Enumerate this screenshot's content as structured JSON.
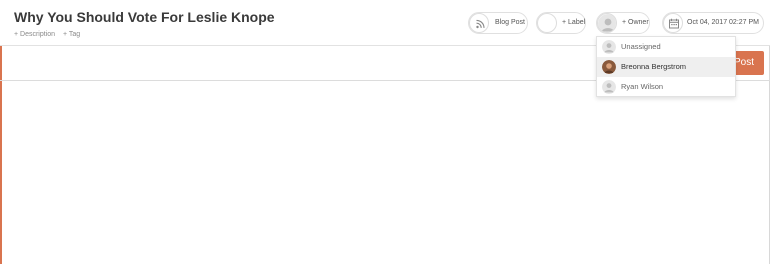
{
  "post": {
    "title": "Why You Should Vote For Leslie Knope",
    "add_description": "+ Description",
    "add_tag": "+ Tag"
  },
  "toolbar": {
    "type_label": "Blog Post",
    "label_label": "+ Label",
    "owner_label": "+ Owner",
    "date_label": "Oct 04, 2017 02:27 PM",
    "post_button": "Post"
  },
  "owner_dropdown": {
    "items": [
      {
        "label": "Unassigned",
        "avatar": "default-avatar-icon",
        "selected": false
      },
      {
        "label": "Breonna Bergstrom",
        "avatar": "user-photo",
        "selected": true
      },
      {
        "label": "Ryan Wilson",
        "avatar": "default-avatar-icon",
        "selected": false
      }
    ]
  },
  "colors": {
    "accent": "#d9744f",
    "hover_bg": "#efefef"
  }
}
